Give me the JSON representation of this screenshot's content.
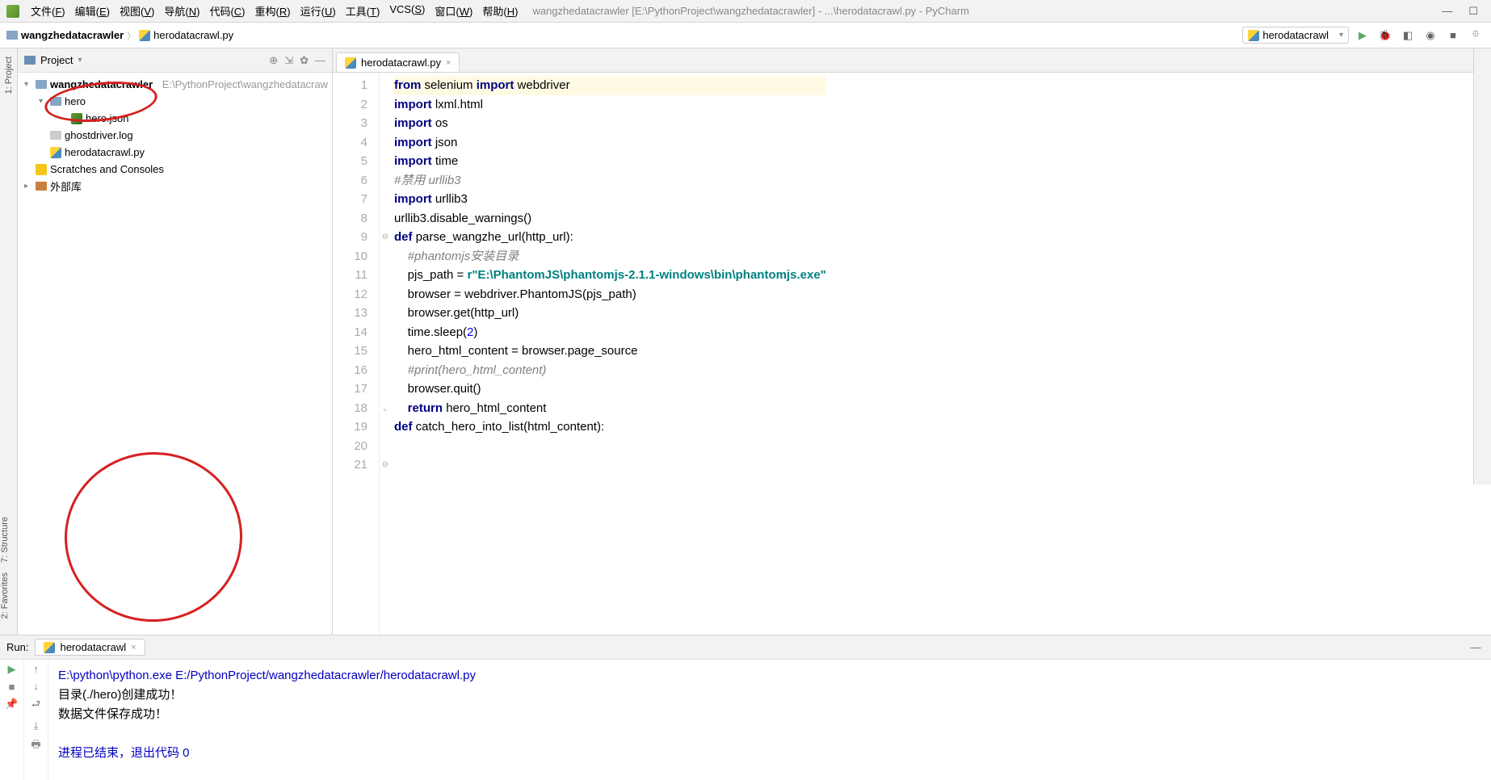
{
  "window": {
    "title": "wangzhedatacrawler [E:\\PythonProject\\wangzhedatacrawler] - ...\\herodatacrawl.py - PyCharm"
  },
  "menu": {
    "items": [
      "文件(F)",
      "编辑(E)",
      "视图(V)",
      "导航(N)",
      "代码(C)",
      "重构(R)",
      "运行(U)",
      "工具(T)",
      "VCS(S)",
      "窗口(W)",
      "帮助(H)"
    ]
  },
  "breadcrumb": {
    "items": [
      "wangzhedatacrawler",
      "herodatacrawl.py"
    ]
  },
  "run_config": {
    "label": "herodatacrawl"
  },
  "project": {
    "title": "Project",
    "root": {
      "name": "wangzhedatacrawler",
      "path": "E:\\PythonProject\\wangzhedatacraw"
    },
    "children": [
      {
        "type": "folder",
        "name": "hero",
        "depth": 1,
        "expanded": true
      },
      {
        "type": "json",
        "name": "hero.json",
        "depth": 2
      },
      {
        "type": "file",
        "name": "ghostdriver.log",
        "depth": 1
      },
      {
        "type": "py",
        "name": "herodatacrawl.py",
        "depth": 1
      },
      {
        "type": "scratch",
        "name": "Scratches and Consoles",
        "depth": 0
      },
      {
        "type": "lib",
        "name": "外部库",
        "depth": 0
      }
    ]
  },
  "tabs": {
    "active": "herodatacrawl.py"
  },
  "code": {
    "lines": [
      {
        "n": 1,
        "parts": [
          {
            "c": "kw",
            "t": "from "
          },
          {
            "c": "",
            "t": "selenium "
          },
          {
            "c": "kw",
            "t": "import "
          },
          {
            "c": "",
            "t": "webdriver"
          }
        ]
      },
      {
        "n": 2,
        "parts": [
          {
            "c": "kw",
            "t": "import "
          },
          {
            "c": "",
            "t": "lxml.html"
          }
        ]
      },
      {
        "n": 3,
        "parts": [
          {
            "c": "kw",
            "t": "import "
          },
          {
            "c": "",
            "t": "os"
          }
        ]
      },
      {
        "n": 4,
        "parts": [
          {
            "c": "kw",
            "t": "import "
          },
          {
            "c": "",
            "t": "json"
          }
        ]
      },
      {
        "n": 5,
        "parts": [
          {
            "c": "kw",
            "t": "import "
          },
          {
            "c": "",
            "t": "time"
          }
        ]
      },
      {
        "n": 6,
        "parts": [
          {
            "c": "cm",
            "t": "#禁用 urllib3"
          }
        ]
      },
      {
        "n": 7,
        "parts": [
          {
            "c": "kw",
            "t": "import "
          },
          {
            "c": "",
            "t": "urllib3"
          }
        ]
      },
      {
        "n": 8,
        "parts": [
          {
            "c": "",
            "t": "urllib3.disable_warnings()"
          }
        ]
      },
      {
        "n": 9,
        "parts": [
          {
            "c": "kw",
            "t": "def "
          },
          {
            "c": "fn",
            "t": "parse_wangzhe_url(http_url):"
          }
        ]
      },
      {
        "n": 10,
        "parts": [
          {
            "c": "",
            "t": "    "
          },
          {
            "c": "cm",
            "t": "#phantomjs安装目录"
          }
        ]
      },
      {
        "n": 11,
        "parts": [
          {
            "c": "",
            "t": "    pjs_path = "
          },
          {
            "c": "st",
            "t": "r\"E:\\PhantomJS\\phantomjs-2.1.1-windows\\bin\\phantomjs.exe\""
          }
        ]
      },
      {
        "n": 12,
        "parts": [
          {
            "c": "",
            "t": "    browser = webdriver.PhantomJS(pjs_path)"
          }
        ]
      },
      {
        "n": 13,
        "parts": [
          {
            "c": "",
            "t": "    browser.get(http_url)"
          }
        ]
      },
      {
        "n": 14,
        "parts": [
          {
            "c": "",
            "t": "    time.sleep("
          },
          {
            "c": "nm",
            "t": "2"
          },
          {
            "c": "",
            "t": ")"
          }
        ]
      },
      {
        "n": 15,
        "parts": [
          {
            "c": "",
            "t": "    hero_html_content = browser.page_source"
          }
        ]
      },
      {
        "n": 16,
        "parts": [
          {
            "c": "",
            "t": "    "
          },
          {
            "c": "cm",
            "t": "#print(hero_html_content)"
          }
        ]
      },
      {
        "n": 17,
        "parts": [
          {
            "c": "",
            "t": "    browser.quit()"
          }
        ]
      },
      {
        "n": 18,
        "parts": [
          {
            "c": "",
            "t": "    "
          },
          {
            "c": "kw",
            "t": "return "
          },
          {
            "c": "",
            "t": "hero_html_content"
          }
        ]
      },
      {
        "n": 19,
        "parts": [
          {
            "c": "",
            "t": ""
          }
        ]
      },
      {
        "n": 20,
        "parts": [
          {
            "c": "",
            "t": ""
          }
        ]
      },
      {
        "n": 21,
        "parts": [
          {
            "c": "kw",
            "t": "def "
          },
          {
            "c": "fn",
            "t": "catch_hero_into_list(html_content):"
          }
        ]
      }
    ]
  },
  "run_panel": {
    "label": "Run:",
    "tab": "herodatacrawl",
    "lines": [
      {
        "style": "blue",
        "text": "E:\\python\\python.exe E:/PythonProject/wangzhedatacrawler/herodatacrawl.py"
      },
      {
        "style": "",
        "text": "目录(./hero)创建成功！"
      },
      {
        "style": "",
        "text": "数据文件保存成功！"
      },
      {
        "style": "",
        "text": ""
      },
      {
        "style": "blue",
        "text": "进程已结束，退出代码 0"
      }
    ]
  },
  "left_rail": {
    "items": [
      "1: Project"
    ]
  },
  "left_rail_bottom": {
    "items": [
      "7: Structure",
      "2: Favorites"
    ]
  }
}
